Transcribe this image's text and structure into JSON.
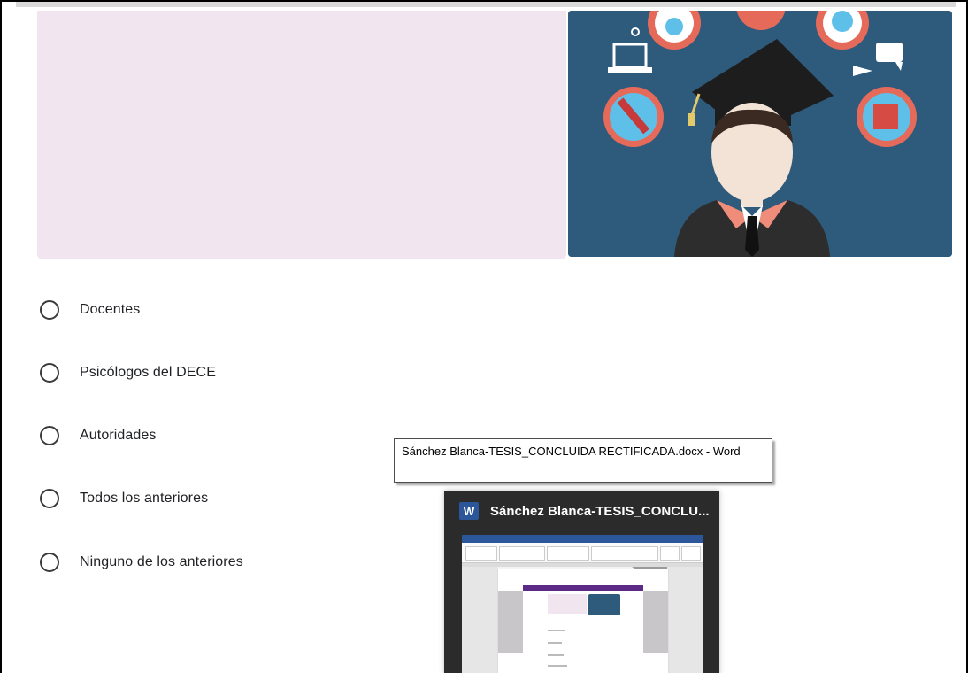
{
  "form": {
    "options": [
      {
        "label": "Docentes"
      },
      {
        "label": "Psicólogos del DECE"
      },
      {
        "label": "Autoridades"
      },
      {
        "label": "Todos los anteriores"
      },
      {
        "label": "Ninguno de los anteriores"
      }
    ]
  },
  "tooltip": {
    "text": "Sánchez Blanca-TESIS_CONCLUIDA RECTIFICADA.docx - Word"
  },
  "taskbar_preview": {
    "app_icon": "word-icon",
    "app_letter": "W",
    "title": "Sánchez Blanca-TESIS_CONCLU..."
  },
  "colors": {
    "banner_bg": "#f1e5ef",
    "header_image_bg": "#2e5a7c",
    "word_blue": "#2b579a",
    "preview_bg": "#2b2b2b"
  }
}
